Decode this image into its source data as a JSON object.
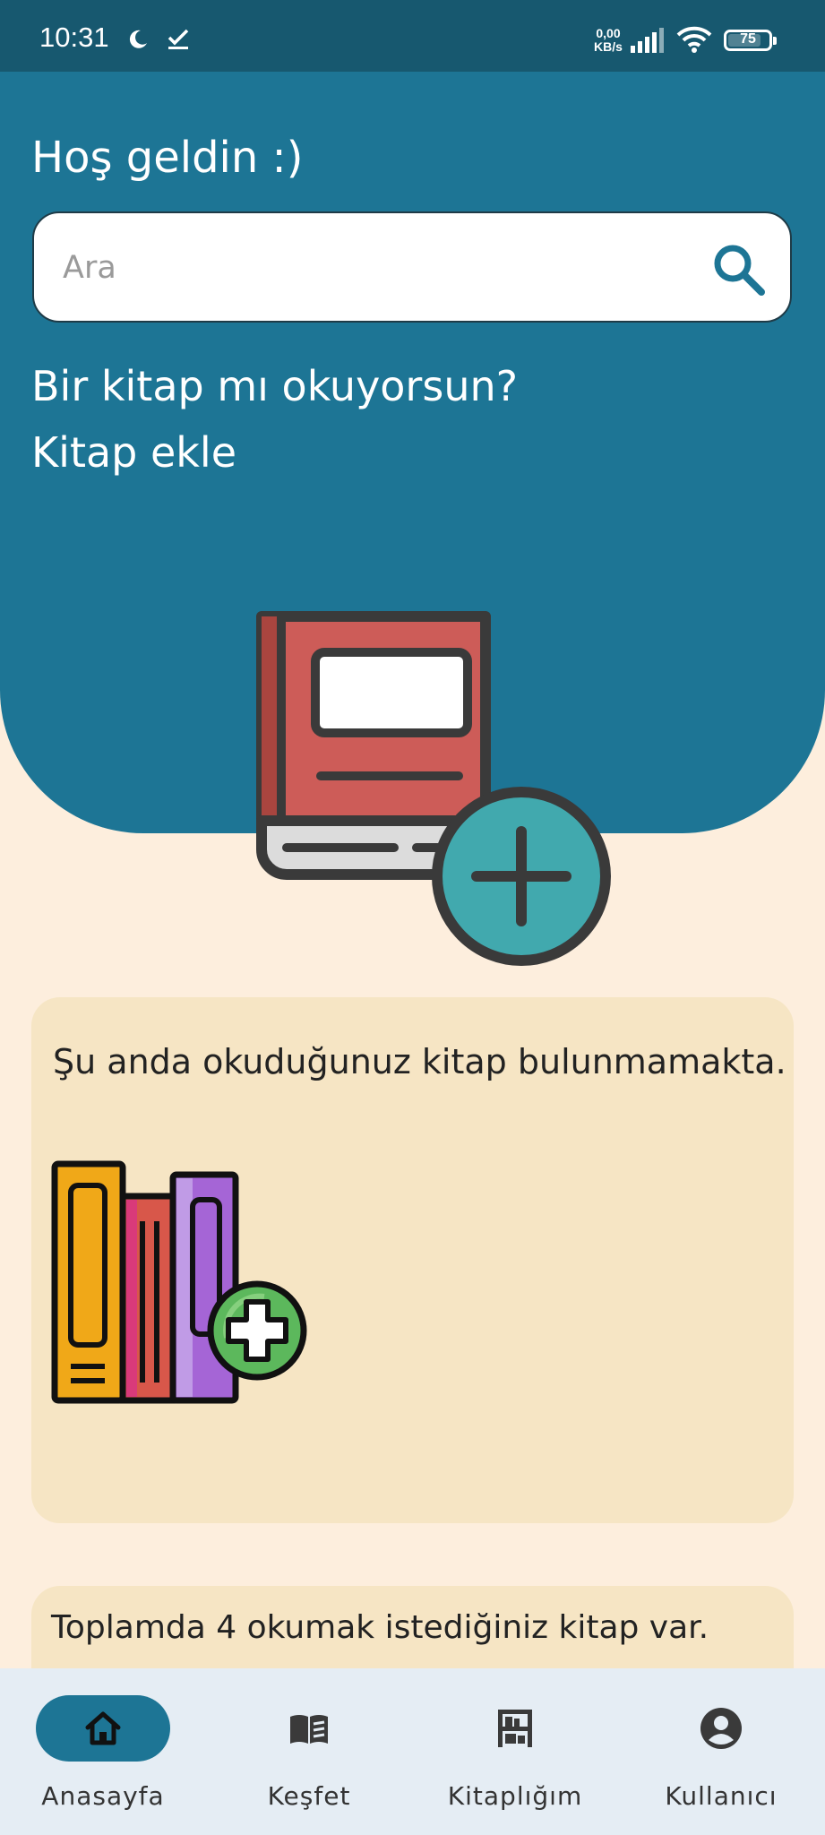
{
  "status_bar": {
    "time": "10:31",
    "net_speed_value": "0,00",
    "net_speed_unit": "KB/s",
    "battery": "75"
  },
  "header": {
    "greeting": "Hoş geldin :)"
  },
  "search": {
    "placeholder": "Ara"
  },
  "add_book": {
    "question": "Bir kitap mı okuyorsun?",
    "link": "Kitap ekle"
  },
  "current_reading": {
    "message": "Şu anda okuduğunuz kitap bulunmamakta."
  },
  "want_to_read": {
    "message": "Toplamda 4 okumak istediğiniz kitap var."
  },
  "nav": {
    "items": [
      {
        "label": "Anasayfa",
        "icon": "home-icon",
        "active": true
      },
      {
        "label": "Keşfet",
        "icon": "open-book-icon",
        "active": false
      },
      {
        "label": "Kitaplığım",
        "icon": "bookshelf-icon",
        "active": false
      },
      {
        "label": "Kullanıcı",
        "icon": "user-icon",
        "active": false
      }
    ]
  },
  "colors": {
    "primary": "#1d7595",
    "status_bar": "#17586f",
    "background": "#fdeedd",
    "card": "#f6e5c4",
    "nav_background": "#e5edf4"
  }
}
